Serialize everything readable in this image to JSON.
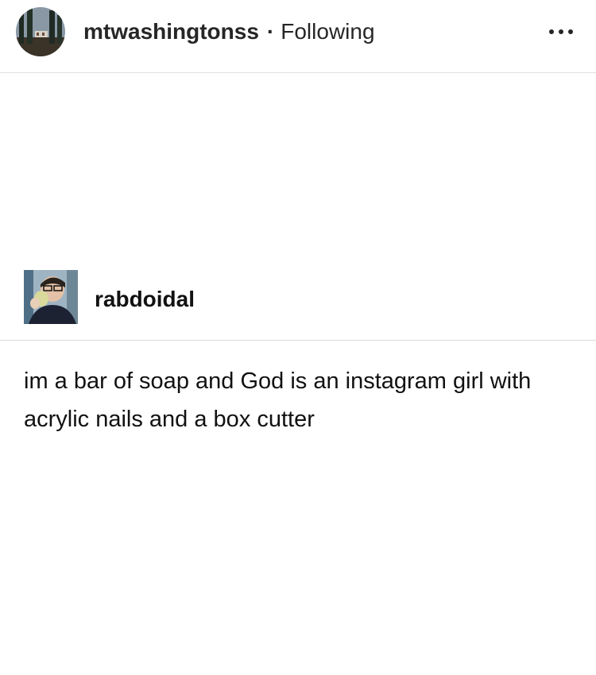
{
  "header": {
    "username": "mtwashingtonss",
    "separator": "·",
    "follow_status": "Following",
    "more_icon": "ellipsis-icon"
  },
  "post": {
    "author": "rabdoidal",
    "text": "im a bar of soap and God is an instagram girl with acrylic nails and a box cutter"
  },
  "colors": {
    "background": "#ffffff",
    "text": "#111111",
    "divider": "#dcdcdc"
  }
}
